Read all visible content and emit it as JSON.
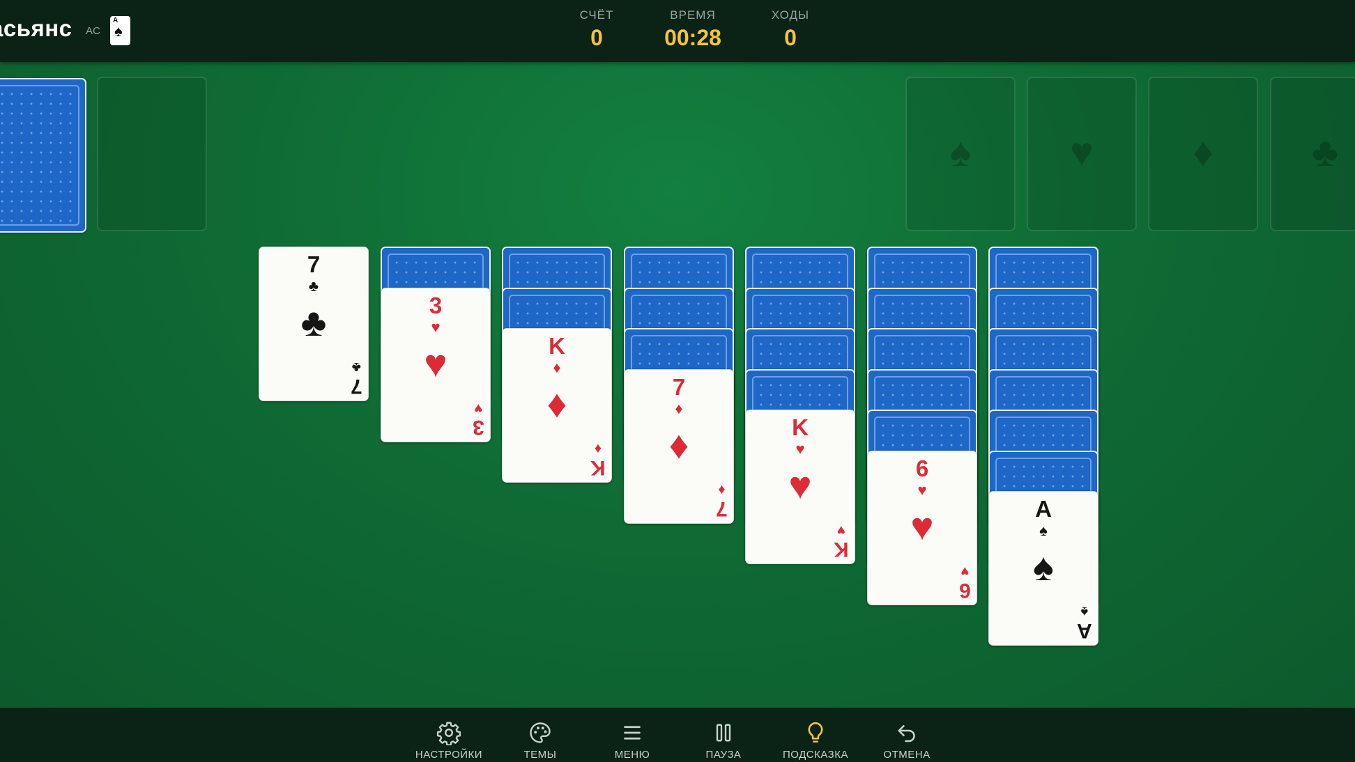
{
  "header": {
    "title": "асьянс",
    "title_suffix": "AC",
    "logo_card": {
      "rank": "A",
      "suit": "♠"
    },
    "stats": {
      "score_label": "СЧЁТ",
      "score_value": "0",
      "time_label": "ВРЕМЯ",
      "time_value": "00:28",
      "moves_label": "ХОДЫ",
      "moves_value": "0"
    }
  },
  "colors": {
    "felt": "#0f6b34",
    "bar": "#0b2316",
    "accent": "#f5c33b",
    "red_suit": "#dd2b36",
    "black_suit": "#161616",
    "card_back": "#1f67c7"
  },
  "stock": {
    "state": "face-down"
  },
  "waste": {
    "state": "empty"
  },
  "foundations": [
    {
      "suit": "♠",
      "name": "spades"
    },
    {
      "suit": "♥",
      "name": "hearts"
    },
    {
      "suit": "♦",
      "name": "diamonds"
    },
    {
      "suit": "♣",
      "name": "clubs"
    }
  ],
  "tableau": [
    {
      "hidden": 0,
      "top": {
        "rank": "7",
        "suit": "♣",
        "color": "black"
      }
    },
    {
      "hidden": 1,
      "top": {
        "rank": "3",
        "suit": "♥",
        "color": "red"
      }
    },
    {
      "hidden": 2,
      "top": {
        "rank": "K",
        "suit": "♦",
        "color": "red"
      }
    },
    {
      "hidden": 3,
      "top": {
        "rank": "7",
        "suit": "♦",
        "color": "red"
      }
    },
    {
      "hidden": 4,
      "top": {
        "rank": "K",
        "suit": "♥",
        "color": "red"
      }
    },
    {
      "hidden": 5,
      "top": {
        "rank": "6",
        "suit": "♥",
        "color": "red"
      }
    },
    {
      "hidden": 6,
      "top": {
        "rank": "A",
        "suit": "♠",
        "color": "black"
      }
    }
  ],
  "toolbar": {
    "settings_label": "НАСТРОЙКИ",
    "themes_label": "ТЕМЫ",
    "menu_label": "МЕНЮ",
    "pause_label": "ПАУЗА",
    "hint_label": "ПОДСКАЗКА",
    "undo_label": "ОТМЕНА"
  }
}
